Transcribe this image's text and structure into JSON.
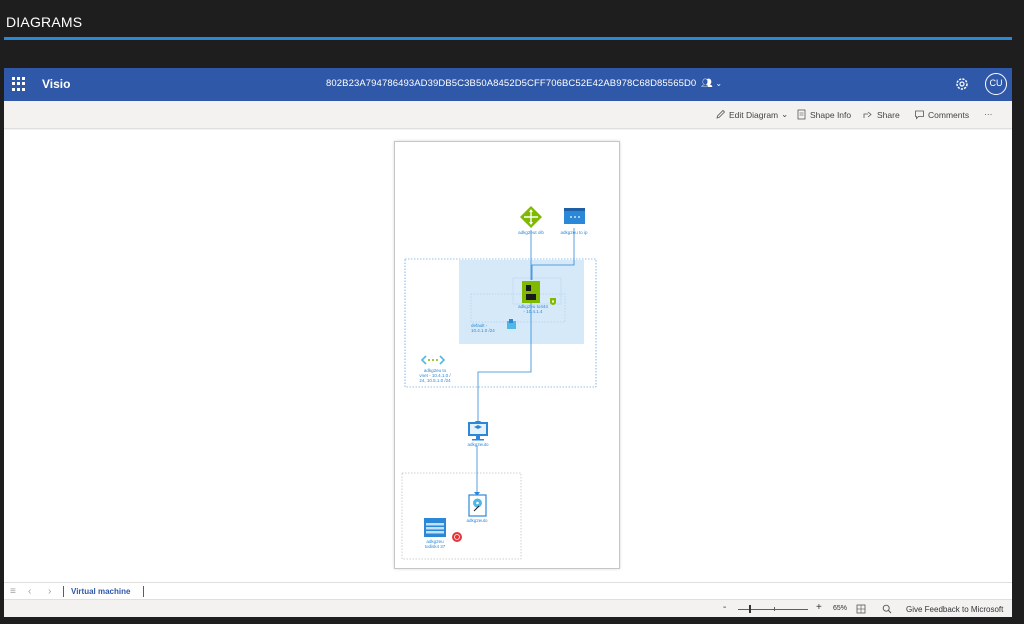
{
  "outer": {
    "title": "DIAGRAMS"
  },
  "header": {
    "app_name": "Visio",
    "doc_title": "802B23A794786493AD39DB5C3B50A8452D5CFF706BC52E42AB978C68D85565D0",
    "avatar_initials": "CU",
    "accent_color": "#2f58a8"
  },
  "ribbon": {
    "edit_diagram": "Edit Diagram",
    "shape_info": "Shape Info",
    "share": "Share",
    "comments": "Comments",
    "more": "···"
  },
  "diagram": {
    "labels": {
      "lb": "adkg2eut olb",
      "pip": "adkg2eu to ip",
      "nic": "adkg2eu to444\n- 10.4.1.4",
      "subnet": "default -\n10.4.1.0 /24",
      "vnet": "adkg2eu to\nvnet - 10.4.1.0 /\n24, 10.5.1.0 /24",
      "vm": "adkg2euto",
      "disk": "adkg2euto",
      "storage": "adkg2eu\ntodisk4 37"
    },
    "icons": [
      "load-balancer-icon",
      "public-ip-icon",
      "network-interface-icon",
      "nsg-shield-icon",
      "subnet-icon",
      "vnet-icon",
      "virtual-machine-icon",
      "disk-icon",
      "storage-account-icon",
      "alert-icon"
    ]
  },
  "sheets": {
    "active": "Virtual machine"
  },
  "status": {
    "zoom_minus": "-",
    "zoom_plus": "+",
    "zoom_level": "65%",
    "feedback": "Give Feedback to Microsoft"
  }
}
